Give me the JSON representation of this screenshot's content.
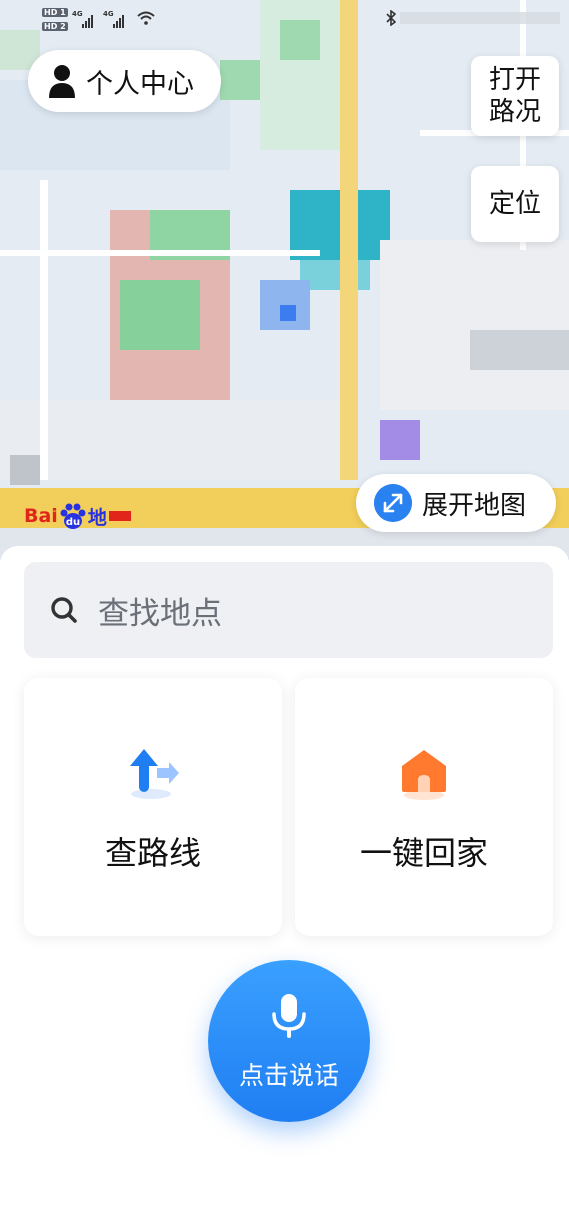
{
  "statusbar": {
    "hd1": "HD 1",
    "hd2": "HD 2",
    "net1": "4G",
    "net2": "4G"
  },
  "map": {
    "personal_center_label": "个人中心",
    "traffic_line1": "打开",
    "traffic_line2": "路况",
    "locate_label": "定位",
    "expand_label": "展开地图",
    "logo_bai": "Bai",
    "logo_du": "du",
    "logo_cn": "地"
  },
  "search": {
    "placeholder": "查找地点"
  },
  "cards": {
    "route_label": "查路线",
    "home_label": "一键回家"
  },
  "voice": {
    "label": "点击说话"
  },
  "colors": {
    "accent": "#1f7ef2",
    "home_icon": "#ff7a2f",
    "map_road": "#f2cf5b"
  },
  "icons": {
    "personal": "person-icon",
    "expand": "expand-arrows-icon",
    "search": "search-icon",
    "route": "route-arrow-icon",
    "home": "home-icon",
    "mic": "microphone-icon"
  }
}
